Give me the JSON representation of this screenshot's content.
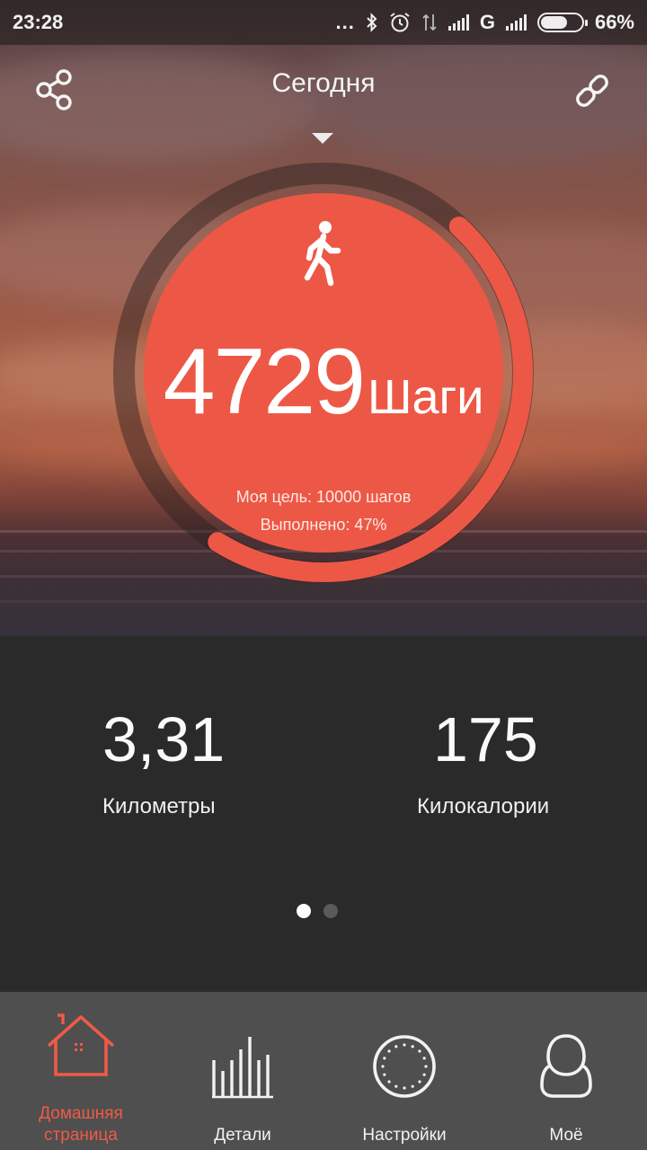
{
  "status_bar": {
    "time": "23:28",
    "dots": "...",
    "network_type": "G",
    "battery_percent": "66%",
    "battery_level": 0.66
  },
  "header": {
    "title": "Сегодня",
    "share_icon": "share-icon",
    "link_icon": "link-icon",
    "dropdown_icon": "chevron-down-icon"
  },
  "activity": {
    "icon": "walking-person-icon",
    "steps": "4729",
    "steps_unit": "Шаги",
    "goal_text": "Моя цель: 10000 шагов",
    "completed_text": "Выполнено: 47%",
    "progress": 0.47,
    "accent_color": "#ec5845"
  },
  "stats": [
    {
      "value": "3,31",
      "label": "Километры"
    },
    {
      "value": "175",
      "label": "Килокалории"
    }
  ],
  "pager": {
    "count": 2,
    "active_index": 0
  },
  "bottom_nav": [
    {
      "label": "Домашняя страница",
      "icon": "home-icon",
      "active": true
    },
    {
      "label": "Детали",
      "icon": "bar-chart-icon",
      "active": false
    },
    {
      "label": "Настройки",
      "icon": "dial-icon",
      "active": false
    },
    {
      "label": "Моё",
      "icon": "profile-icon",
      "active": false
    }
  ],
  "colors": {
    "accent": "#ef5a47",
    "panel": "#2a2a2a",
    "nav": "#4f4f4f"
  }
}
